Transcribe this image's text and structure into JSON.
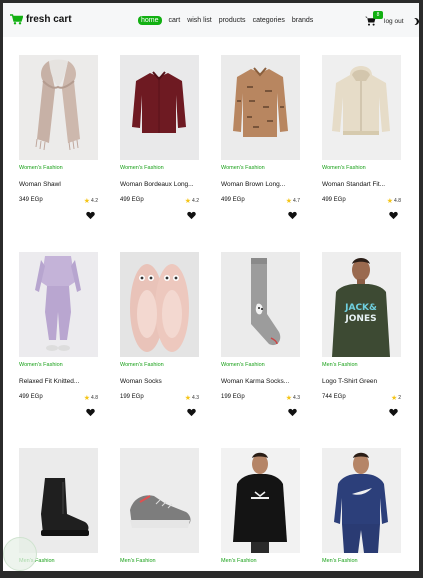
{
  "navbar": {
    "brand": "fresh cart",
    "links": [
      "home",
      "cart",
      "wish list",
      "products",
      "categories",
      "brands"
    ],
    "cart_count": "8",
    "logout": "log out"
  },
  "colors": {
    "accent": "#12b012",
    "category": "#17a017",
    "star": "#f5c518"
  },
  "products": [
    {
      "category": "Women's Fashion",
      "title": "Woman Shawl",
      "price": "349 EGp",
      "rating": "4.2"
    },
    {
      "category": "Women's Fashion",
      "title": "Woman Bordeaux Long...",
      "price": "499 EGp",
      "rating": "4.2"
    },
    {
      "category": "Women's Fashion",
      "title": "Woman Brown Long...",
      "price": "499 EGp",
      "rating": "4.7"
    },
    {
      "category": "Women's Fashion",
      "title": "Woman Standart Fit...",
      "price": "499 EGp",
      "rating": "4.8"
    },
    {
      "category": "Women's Fashion",
      "title": "Relaxed Fit Knitted...",
      "price": "499 EGp",
      "rating": "4.8"
    },
    {
      "category": "Women's Fashion",
      "title": "Woman Socks",
      "price": "199 EGp",
      "rating": "4.3"
    },
    {
      "category": "Women's Fashion",
      "title": "Woman Karma Socks...",
      "price": "199 EGp",
      "rating": "4.3"
    },
    {
      "category": "Men's Fashion",
      "title": "Logo T-Shirt Green",
      "price": "744 EGp",
      "rating": "2"
    },
    {
      "category": "Men's Fashion",
      "title": "",
      "price": "",
      "rating": ""
    },
    {
      "category": "Men's Fashion",
      "title": "",
      "price": "",
      "rating": ""
    },
    {
      "category": "Men's Fashion",
      "title": "",
      "price": "",
      "rating": ""
    },
    {
      "category": "Men's Fashion",
      "title": "",
      "price": "",
      "rating": ""
    }
  ],
  "graphics": {
    "tshirt_print_line1": "JACK&",
    "tshirt_print_line2": "JONES"
  }
}
